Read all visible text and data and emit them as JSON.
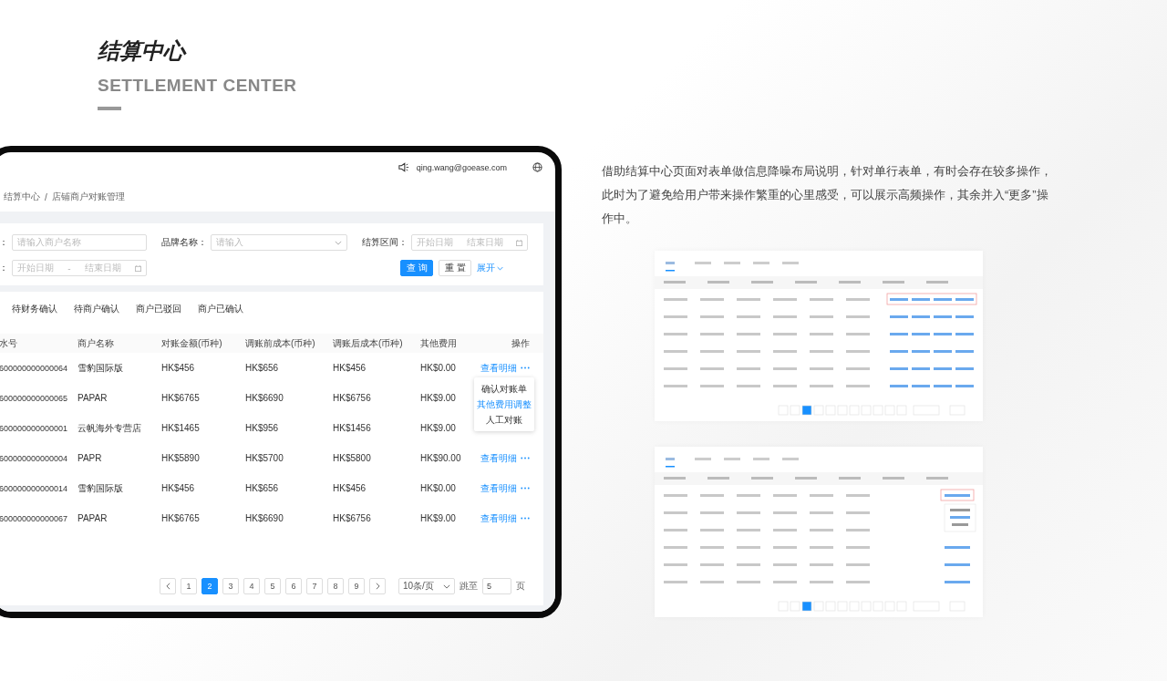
{
  "header": {
    "title": "结算中心",
    "subtitle": "SETTLEMENT CENTER"
  },
  "app": {
    "user_email": "qing.wang@goease.com",
    "breadcrumb": [
      "结算中心",
      "店铺商户对账管理"
    ],
    "breadcrumb_separator": "/",
    "filters": [
      {
        "label": "：",
        "kind": "input",
        "placeholder": "请输入商户名称"
      },
      {
        "label": "品牌名称：",
        "kind": "select",
        "placeholder": "请输入"
      },
      {
        "label": "结算区间：",
        "kind": "daterange",
        "start": "开始日期",
        "end": "结束日期"
      },
      {
        "label": "：",
        "kind": "daterange",
        "start": "开始日期",
        "separator": "-",
        "end": "结束日期"
      }
    ],
    "buttons": [
      {
        "label": "查询",
        "kind": "primary"
      },
      {
        "label": "重置",
        "kind": "default"
      }
    ],
    "expand": "展开",
    "tabs": [
      {
        "label": "待财务确认",
        "selected": false
      },
      {
        "label": "待商户确认",
        "selected": false
      },
      {
        "label": "商户已驳回",
        "selected": false
      },
      {
        "label": "商户已确认",
        "selected": false
      }
    ],
    "table": {
      "columns": [
        "水号",
        "商户名称",
        "对账金额(币种)",
        "调账前成本(币种)",
        "调账后成本(币种)",
        "其他费用",
        "操作"
      ],
      "rows": [
        {
          "cells": [
            "600000000000064",
            "雪豹国际版",
            "HK$456",
            "HK$656",
            "HK$456",
            "HK$0.00"
          ],
          "action": "查看明细"
        },
        {
          "cells": [
            "600000000000065",
            "PAPAR",
            "HK$6765",
            "HK$6690",
            "HK$6756",
            "HK$9.00"
          ]
        },
        {
          "cells": [
            "600000000000001",
            "云帆海外专营店",
            "HK$1465",
            "HK$956",
            "HK$1456",
            "HK$9.00"
          ]
        },
        {
          "cells": [
            "600000000000004",
            "PAPR",
            "HK$5890",
            "HK$5700",
            "HK$5800",
            "HK$90.00"
          ],
          "action": "查看明细"
        },
        {
          "cells": [
            "600000000000014",
            "雪豹国际版",
            "HK$456",
            "HK$656",
            "HK$456",
            "HK$0.00"
          ],
          "action": "查看明细"
        },
        {
          "cells": [
            "600000000000067",
            "PAPAR",
            "HK$6765",
            "HK$6690",
            "HK$6756",
            "HK$9.00"
          ],
          "action": "查看明细"
        }
      ]
    },
    "menu": {
      "items": [
        {
          "label": "确认对账单",
          "highlighted": false
        },
        {
          "label": "其他费用调整",
          "highlighted": true
        },
        {
          "label": "人工对账",
          "highlighted": false
        }
      ]
    },
    "pagination": {
      "pages": [
        {
          "label": "1",
          "selected": false
        },
        {
          "label": "2",
          "selected": true
        },
        {
          "label": "3",
          "selected": false
        },
        {
          "label": "4",
          "selected": false
        },
        {
          "label": "5",
          "selected": false
        },
        {
          "label": "6",
          "selected": false
        },
        {
          "label": "7",
          "selected": false
        },
        {
          "label": "8",
          "selected": false
        },
        {
          "label": "9",
          "selected": false
        }
      ],
      "page_size": "10条/页",
      "jump_label": "跳至",
      "jump_value": "5",
      "page_unit": "页"
    }
  },
  "description": "借助结算中心页面对表单做信息降噪布局说明，针对单行表单，有时会存在较多操作，此时为了避免给用户带来操作繁重的心里感受，可以展示高频操作，其余并入“更多”操作中。",
  "previews": [
    {
      "kind": "inline_actions"
    },
    {
      "kind": "dropdown_actions"
    }
  ]
}
